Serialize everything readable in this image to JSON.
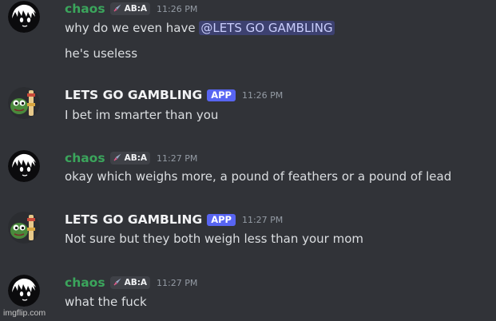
{
  "colors": {
    "background": "#313338",
    "user_chaos": "#3ba55c",
    "user_bot": "#f2f3f5",
    "app_badge": "#5865f2",
    "mention_bg": "#5865f24d"
  },
  "messages": [
    {
      "author": "chaos",
      "tag": {
        "icon": "sword-icon",
        "label": "AB:A"
      },
      "time": "11:26 PM",
      "lines": [
        {
          "text": "why do we even have ",
          "mention": "@LETS GO GAMBLING"
        },
        {
          "text": "he's useless"
        }
      ]
    },
    {
      "author": "LETS GO GAMBLING",
      "badge": "APP",
      "time": "11:26 PM",
      "lines": [
        {
          "text": "I bet im smarter than you"
        }
      ]
    },
    {
      "author": "chaos",
      "tag": {
        "icon": "sword-icon",
        "label": "AB:A"
      },
      "time": "11:27 PM",
      "lines": [
        {
          "text": "okay which weighs more, a pound of feathers or a pound of lead"
        }
      ]
    },
    {
      "author": "LETS GO GAMBLING",
      "badge": "APP",
      "time": "11:27 PM",
      "lines": [
        {
          "text": "Not sure but they both weigh less than your mom"
        }
      ]
    },
    {
      "author": "chaos",
      "tag": {
        "icon": "sword-icon",
        "label": "AB:A"
      },
      "time": "11:27 PM",
      "lines": [
        {
          "text": "what the fuck"
        }
      ]
    }
  ],
  "watermark": "imgflip.com"
}
